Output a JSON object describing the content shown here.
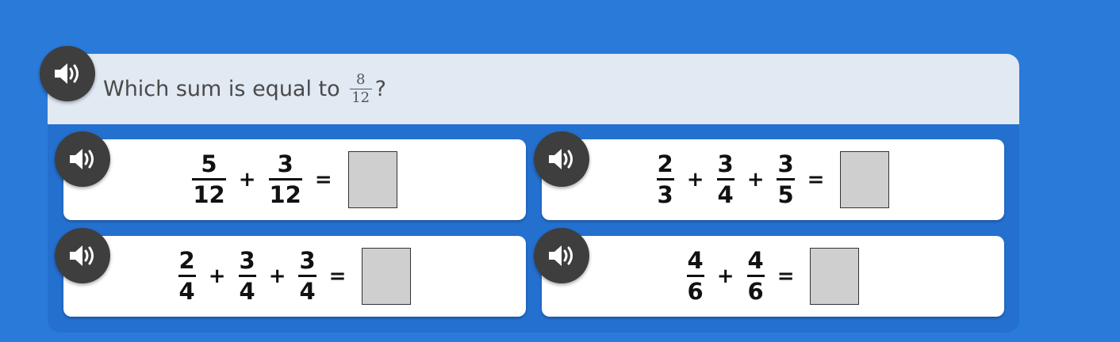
{
  "question": {
    "prefix": "Which sum is equal to",
    "fraction": {
      "num": "8",
      "den": "12"
    },
    "suffix": "?"
  },
  "icons": {
    "speaker": "speaker-volume-icon"
  },
  "colors": {
    "background": "#2a7ad9",
    "card": "#2470cf",
    "question_bar": "#e1e9f3",
    "speaker_button": "#3e3e3e",
    "answer_box": "#cfcfcf"
  },
  "options": [
    {
      "terms": [
        {
          "num": "5",
          "den": "12"
        },
        {
          "num": "3",
          "den": "12"
        }
      ],
      "operator": "+",
      "equals": "="
    },
    {
      "terms": [
        {
          "num": "2",
          "den": "3"
        },
        {
          "num": "3",
          "den": "4"
        },
        {
          "num": "3",
          "den": "5"
        }
      ],
      "operator": "+",
      "equals": "="
    },
    {
      "terms": [
        {
          "num": "2",
          "den": "4"
        },
        {
          "num": "3",
          "den": "4"
        },
        {
          "num": "3",
          "den": "4"
        }
      ],
      "operator": "+",
      "equals": "="
    },
    {
      "terms": [
        {
          "num": "4",
          "den": "6"
        },
        {
          "num": "4",
          "den": "6"
        }
      ],
      "operator": "+",
      "equals": "="
    }
  ]
}
